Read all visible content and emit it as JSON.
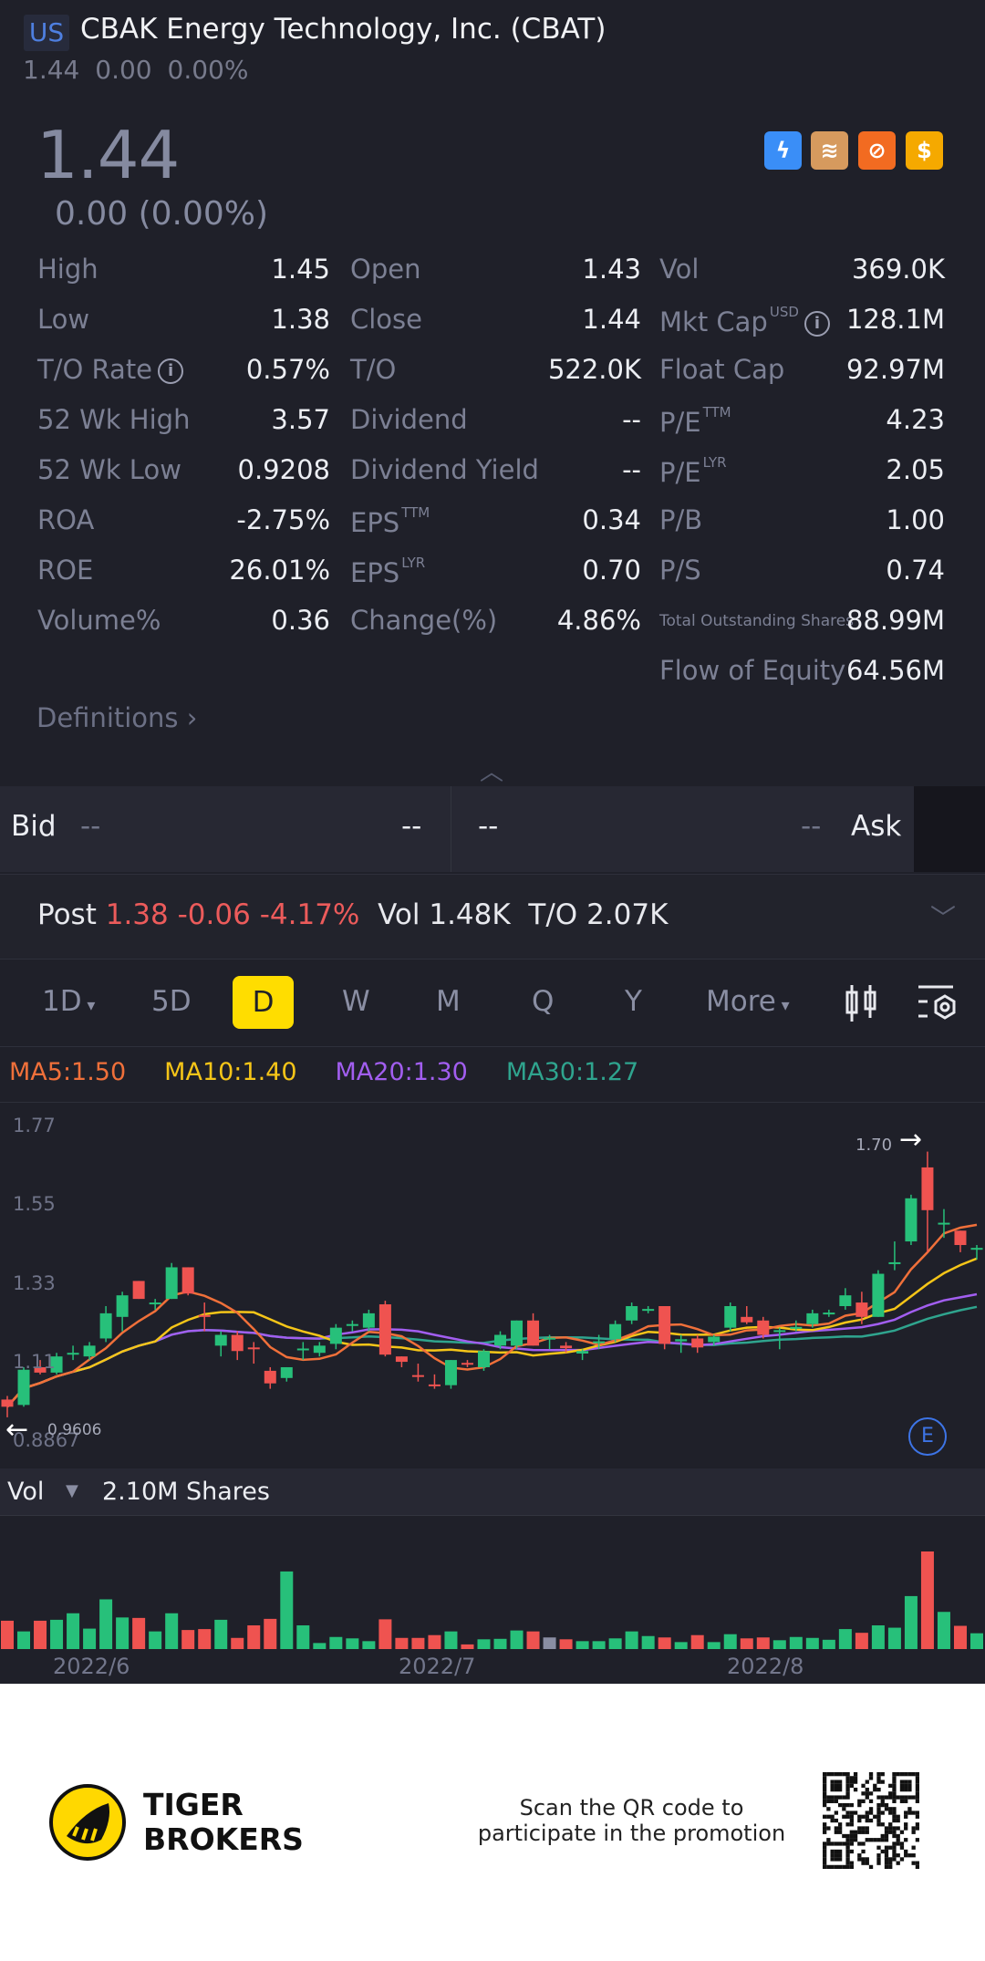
{
  "header": {
    "market": "US",
    "title": "CBAK Energy Technology, Inc. (CBAT)",
    "price": "1.44",
    "change": "0.00",
    "change_pct": "0.00%"
  },
  "quote": {
    "price": "1.44",
    "change_line": "0.00 (0.00%)",
    "badges": [
      {
        "icon": "lightning-level1-icon",
        "color": "#3a8ef7"
      },
      {
        "icon": "layers-a-icon",
        "color": "#d69a5e"
      },
      {
        "icon": "no-short-icon",
        "color": "#f26b21"
      },
      {
        "icon": "dollar-icon",
        "color": "#f5a900"
      }
    ]
  },
  "stats": [
    [
      {
        "label": "High",
        "value": "1.45"
      },
      {
        "label": "Open",
        "value": "1.43"
      },
      {
        "label": "Vol",
        "value": "369.0K"
      }
    ],
    [
      {
        "label": "Low",
        "value": "1.38"
      },
      {
        "label": "Close",
        "value": "1.44"
      },
      {
        "label": "Mkt Cap",
        "sup": "USD",
        "info": "i",
        "value": "128.1M"
      }
    ],
    [
      {
        "label": "T/O Rate",
        "info": "i",
        "value": "0.57%"
      },
      {
        "label": "T/O",
        "value": "522.0K"
      },
      {
        "label": "Float Cap",
        "value": "92.97M"
      }
    ],
    [
      {
        "label": "52 Wk High",
        "value": "3.57"
      },
      {
        "label": "Dividend",
        "value": "--"
      },
      {
        "label": "P/E",
        "sup": "TTM",
        "value": "4.23"
      }
    ],
    [
      {
        "label": "52 Wk Low",
        "value": "0.9208"
      },
      {
        "label": "Dividend Yield",
        "value": "--"
      },
      {
        "label": "P/E",
        "sup": "LYR",
        "value": "2.05"
      }
    ],
    [
      {
        "label": "ROA",
        "value": "-2.75%"
      },
      {
        "label": "EPS",
        "sup": "TTM",
        "value": "0.34"
      },
      {
        "label": "P/B",
        "value": "1.00"
      }
    ],
    [
      {
        "label": "ROE",
        "value": "26.01%"
      },
      {
        "label": "EPS",
        "sup": "LYR",
        "value": "0.70"
      },
      {
        "label": "P/S",
        "value": "0.74"
      }
    ],
    [
      {
        "label": "Volume%",
        "value": "0.36"
      },
      {
        "label": "Change(%)",
        "value": "4.86%"
      },
      {
        "label": "Total Outstanding Shares",
        "small": true,
        "value": "88.99M"
      }
    ],
    [
      null,
      null,
      {
        "label": "Flow of Equity",
        "value": "64.56M"
      }
    ]
  ],
  "definitions": "Definitions",
  "bidask": {
    "bid_label": "Bid",
    "bid_price": "--",
    "bid_size": "--",
    "ask_price": "--",
    "ask_size": "--",
    "ask_label": "Ask"
  },
  "post": {
    "label": "Post",
    "price": "1.38",
    "change": "-0.06",
    "change_pct": "-4.17%",
    "vol_label": "Vol",
    "vol": "1.48K",
    "to_label": "T/O",
    "to": "2.07K"
  },
  "periods": {
    "p1d": "1D",
    "p5d": "5D",
    "d": "D",
    "w": "W",
    "m": "M",
    "q": "Q",
    "y": "Y",
    "more": "More",
    "active": "D"
  },
  "ma": {
    "ma5": "MA5:1.50",
    "ma10": "MA10:1.40",
    "ma20": "MA20:1.30",
    "ma30": "MA30:1.27",
    "colors": {
      "ma5": "#f0703a",
      "ma10": "#f5c518",
      "ma20": "#a25ef0",
      "ma30": "#2fa48e"
    }
  },
  "chart_data": {
    "type": "candlestick",
    "price_ticks": [
      "1.77",
      "1.55",
      "1.33",
      "1.11",
      "0.8867"
    ],
    "ylim": [
      0.8867,
      1.77
    ],
    "max_label": "1.70",
    "min_label": "0.9606",
    "earnings_marker": "E",
    "colors": {
      "up": "#27c07a",
      "down": "#ef5350",
      "flat": "#8a8ea3"
    },
    "ohlc": [
      [
        1.01,
        1.02,
        0.9606,
        0.99
      ],
      [
        0.995,
        1.1,
        0.99,
        1.093
      ],
      [
        1.1,
        1.12,
        1.08,
        1.085
      ],
      [
        1.085,
        1.14,
        1.08,
        1.13
      ],
      [
        1.135,
        1.16,
        1.12,
        1.14
      ],
      [
        1.13,
        1.17,
        1.12,
        1.16
      ],
      [
        1.18,
        1.27,
        1.17,
        1.25
      ],
      [
        1.24,
        1.31,
        1.2,
        1.3
      ],
      [
        1.34,
        1.34,
        1.29,
        1.29
      ],
      [
        1.275,
        1.29,
        1.26,
        1.28
      ],
      [
        1.29,
        1.39,
        1.29,
        1.378
      ],
      [
        1.378,
        1.378,
        1.3,
        1.305
      ],
      [
        1.245,
        1.28,
        1.2,
        1.24
      ],
      [
        1.16,
        1.2,
        1.13,
        1.19
      ],
      [
        1.19,
        1.2,
        1.12,
        1.145
      ],
      [
        1.155,
        1.17,
        1.11,
        1.15
      ],
      [
        1.09,
        1.1,
        1.04,
        1.055
      ],
      [
        1.07,
        1.1,
        1.06,
        1.1
      ],
      [
        1.148,
        1.17,
        1.12,
        1.152
      ],
      [
        1.14,
        1.17,
        1.13,
        1.16
      ],
      [
        1.165,
        1.22,
        1.15,
        1.21
      ],
      [
        1.215,
        1.23,
        1.2,
        1.22
      ],
      [
        1.21,
        1.26,
        1.2,
        1.25
      ],
      [
        1.275,
        1.285,
        1.13,
        1.135
      ],
      [
        1.13,
        1.13,
        1.1,
        1.115
      ],
      [
        1.078,
        1.11,
        1.06,
        1.075
      ],
      [
        1.052,
        1.08,
        1.04,
        1.05
      ],
      [
        1.05,
        1.12,
        1.04,
        1.12
      ],
      [
        1.112,
        1.12,
        1.1,
        1.108
      ],
      [
        1.1,
        1.15,
        1.09,
        1.145
      ],
      [
        1.16,
        1.2,
        1.15,
        1.19
      ],
      [
        1.16,
        1.23,
        1.15,
        1.23
      ],
      [
        1.23,
        1.25,
        1.16,
        1.16
      ],
      [
        1.178,
        1.19,
        1.15,
        1.182
      ],
      [
        1.16,
        1.17,
        1.14,
        1.153
      ],
      [
        1.138,
        1.15,
        1.12,
        1.145
      ],
      [
        1.168,
        1.19,
        1.15,
        1.172
      ],
      [
        1.178,
        1.23,
        1.17,
        1.22
      ],
      [
        1.23,
        1.28,
        1.22,
        1.27
      ],
      [
        1.258,
        1.27,
        1.25,
        1.262
      ],
      [
        1.27,
        1.27,
        1.15,
        1.165
      ],
      [
        1.172,
        1.19,
        1.14,
        1.178
      ],
      [
        1.18,
        1.19,
        1.14,
        1.155
      ],
      [
        1.17,
        1.19,
        1.16,
        1.185
      ],
      [
        1.21,
        1.28,
        1.2,
        1.27
      ],
      [
        1.24,
        1.27,
        1.22,
        1.225
      ],
      [
        1.23,
        1.24,
        1.18,
        1.19
      ],
      [
        1.198,
        1.21,
        1.15,
        1.203
      ],
      [
        1.208,
        1.23,
        1.2,
        1.212
      ],
      [
        1.22,
        1.26,
        1.21,
        1.25
      ],
      [
        1.248,
        1.26,
        1.24,
        1.252
      ],
      [
        1.27,
        1.32,
        1.26,
        1.3
      ],
      [
        1.28,
        1.31,
        1.22,
        1.24
      ],
      [
        1.24,
        1.37,
        1.24,
        1.36
      ],
      [
        1.388,
        1.45,
        1.37,
        1.392
      ],
      [
        1.45,
        1.58,
        1.44,
        1.57
      ],
      [
        1.656,
        1.7,
        1.42,
        1.537
      ],
      [
        1.498,
        1.54,
        1.46,
        1.502
      ],
      [
        1.48,
        1.48,
        1.42,
        1.44
      ],
      [
        1.428,
        1.44,
        1.4,
        1.432
      ]
    ],
    "volume": {
      "label": "Vol",
      "value": "2.10M Shares",
      "max_millions": 2.1,
      "values_millions": [
        0.61,
        0.38,
        0.61,
        0.63,
        0.77,
        0.44,
        1.07,
        0.68,
        0.67,
        0.38,
        0.77,
        0.41,
        0.43,
        0.63,
        0.24,
        0.51,
        0.65,
        1.67,
        0.51,
        0.13,
        0.26,
        0.23,
        0.17,
        0.64,
        0.24,
        0.24,
        0.3,
        0.38,
        0.1,
        0.21,
        0.22,
        0.4,
        0.38,
        0.25,
        0.21,
        0.17,
        0.17,
        0.23,
        0.38,
        0.28,
        0.25,
        0.15,
        0.3,
        0.15,
        0.32,
        0.23,
        0.25,
        0.19,
        0.26,
        0.24,
        0.2,
        0.43,
        0.35,
        0.51,
        0.46,
        1.14,
        2.1,
        0.8,
        0.5,
        0.34
      ],
      "direction": [
        "d",
        "u",
        "d",
        "u",
        "u",
        "u",
        "u",
        "u",
        "d",
        "u",
        "u",
        "d",
        "d",
        "u",
        "d",
        "d",
        "d",
        "u",
        "u",
        "u",
        "u",
        "u",
        "u",
        "d",
        "d",
        "d",
        "d",
        "u",
        "d",
        "u",
        "u",
        "u",
        "d",
        "f",
        "d",
        "u",
        "u",
        "u",
        "u",
        "u",
        "d",
        "u",
        "d",
        "u",
        "u",
        "d",
        "d",
        "u",
        "u",
        "u",
        "u",
        "u",
        "d",
        "u",
        "u",
        "u",
        "d",
        "u",
        "d",
        "u"
      ]
    },
    "x_ticks": [
      "2022/6",
      "2022/7",
      "2022/8"
    ]
  },
  "footer": {
    "brand_line1": "TIGER",
    "brand_line2": "BROKERS",
    "scan_line1": "Scan the QR code to",
    "scan_line2": "participate in the promotion"
  }
}
